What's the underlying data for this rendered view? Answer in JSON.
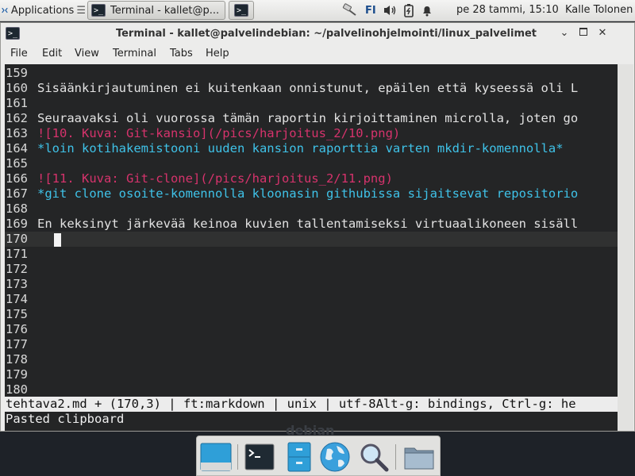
{
  "panel": {
    "apps_label": "Applications",
    "task_label": "Terminal - kallet@p...",
    "keyboard_layout": "FI",
    "clock": "pe 28 tammi, 15:10",
    "user": "Kalle Tolonen"
  },
  "window": {
    "title": "Terminal - kallet@palvelindebian: ~/palvelinohjelmointi/linux_palvelimet",
    "menu": [
      "File",
      "Edit",
      "View",
      "Terminal",
      "Tabs",
      "Help"
    ]
  },
  "editor": {
    "lines": [
      {
        "num": "159",
        "text": "",
        "style": "normal"
      },
      {
        "num": "160",
        "text": "Sisäänkirjautuminen ei kuitenkaan onnistunut, epäilen että kyseessä oli L",
        "style": "normal"
      },
      {
        "num": "161",
        "text": "",
        "style": "normal"
      },
      {
        "num": "162",
        "text": "Seuraavaksi oli vuorossa tämän raportin kirjoittaminen microlla, joten go",
        "style": "normal"
      },
      {
        "num": "163",
        "text": "![10. Kuva: Git-kansio](/pics/harjoitus_2/10.png)",
        "style": "pink"
      },
      {
        "num": "164",
        "text": "*loin kotihakemistooni uuden kansion raporttia varten mkdir-komennolla*",
        "style": "cyan"
      },
      {
        "num": "165",
        "text": "",
        "style": "normal"
      },
      {
        "num": "166",
        "text": "![11. Kuva: Git-clone](/pics/harjoitus_2/11.png)",
        "style": "pink"
      },
      {
        "num": "167",
        "text": "*git clone osoite-komennolla kloonasin githubissa sijaitsevat repositorio",
        "style": "cyan"
      },
      {
        "num": "168",
        "text": "",
        "style": "normal"
      },
      {
        "num": "169",
        "text": "En keksinyt järkevää keinoa kuvien tallentamiseksi virtuaalikoneen sisäll",
        "style": "normal"
      },
      {
        "num": "170",
        "text": "",
        "style": "current"
      },
      {
        "num": "171",
        "text": "",
        "style": "normal"
      },
      {
        "num": "172",
        "text": "",
        "style": "normal"
      },
      {
        "num": "173",
        "text": "",
        "style": "normal"
      },
      {
        "num": "174",
        "text": "",
        "style": "normal"
      },
      {
        "num": "175",
        "text": "",
        "style": "normal"
      },
      {
        "num": "176",
        "text": "",
        "style": "normal"
      },
      {
        "num": "177",
        "text": "",
        "style": "normal"
      },
      {
        "num": "178",
        "text": "",
        "style": "normal"
      },
      {
        "num": "179",
        "text": "",
        "style": "normal"
      },
      {
        "num": "180",
        "text": "",
        "style": "normal"
      }
    ],
    "status_line": "tehtava2.md + (170,3) | ft:markdown | unix | utf-8Alt-g: bindings, Ctrl-g: he",
    "message": "Pasted clipboard"
  },
  "desktop": {
    "brand": "debian"
  },
  "dock": {
    "items": [
      "show-desktop",
      "terminal",
      "file-manager",
      "web-browser",
      "app-finder",
      "home-folder"
    ]
  },
  "colors": {
    "terminal_bg": "#242526",
    "markdown_image": "#d6336c",
    "markdown_emphasis": "#3fc2e8",
    "status_bar": "#ececec"
  }
}
